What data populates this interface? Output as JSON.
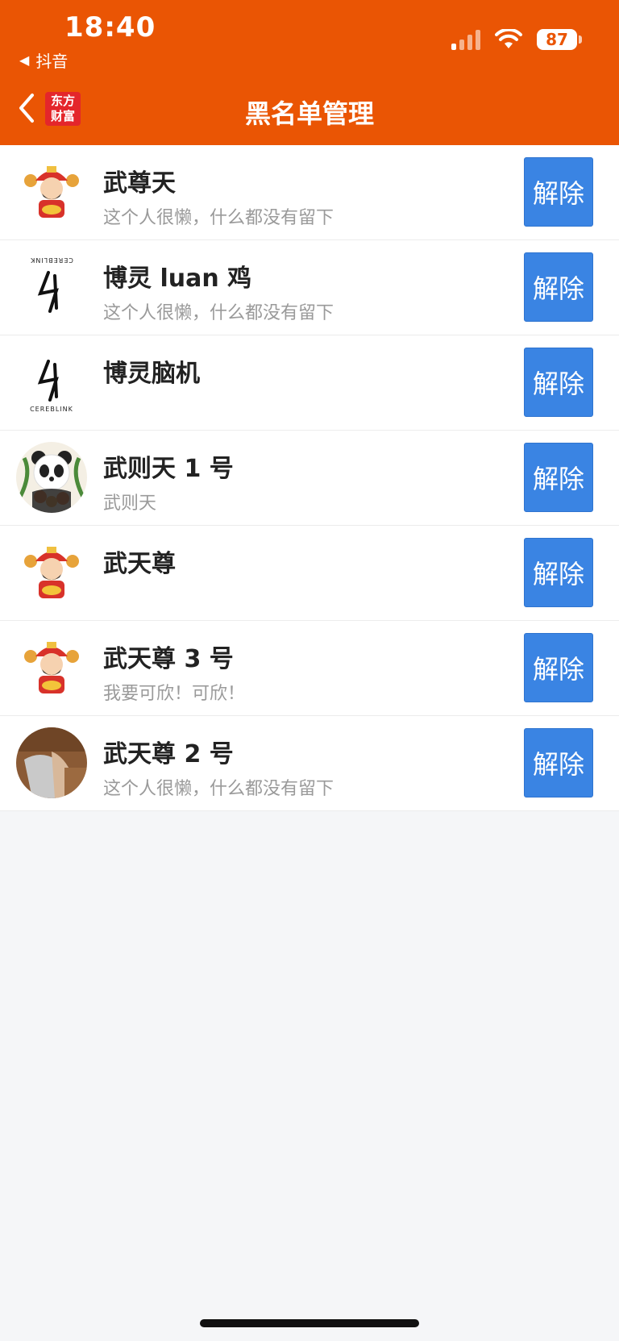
{
  "status_bar": {
    "time": "18:40",
    "back_app_label": "抖音",
    "battery": "87"
  },
  "nav": {
    "title": "黑名单管理",
    "logo_line1": "东方",
    "logo_line2": "财富"
  },
  "unblock_label": "解除",
  "rows": [
    {
      "name": "武尊天",
      "desc": "这个人很懒，什么都没有留下",
      "avatar": "caishen"
    },
    {
      "name": "博灵 luan 鸡",
      "desc": "这个人很懒，什么都没有留下",
      "avatar": "cereblink-flipped",
      "logo_text": "CEREBLINK"
    },
    {
      "name": "博灵脑机",
      "desc": "",
      "avatar": "cereblink",
      "logo_text": "CEREBLINK"
    },
    {
      "name": "武则天 1 号",
      "desc": "武则天",
      "avatar": "panda"
    },
    {
      "name": "武天尊",
      "desc": "",
      "avatar": "caishen"
    },
    {
      "name": "武天尊 3 号",
      "desc": "我要可欣！可欣！",
      "avatar": "caishen"
    },
    {
      "name": "武天尊 2 号",
      "desc": "这个人很懒，什么都没有留下",
      "avatar": "photo"
    }
  ],
  "colors": {
    "header": "#ea5504",
    "button": "#3a84e3",
    "background": "#f5f6f8"
  }
}
